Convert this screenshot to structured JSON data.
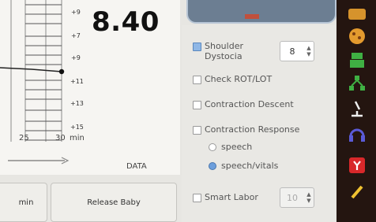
{
  "chart": {
    "scale_labels": [
      "+9",
      "+7",
      "+9",
      "+11",
      "+13",
      "+15"
    ],
    "x_ticks": [
      "25",
      "30"
    ],
    "x_unit": "min",
    "current_value": "8.40",
    "data_label": "DATA"
  },
  "buttons": {
    "min_label": "min",
    "release_baby": "Release Baby"
  },
  "options": {
    "shoulder_dystocia": {
      "label_line1": "Shoulder",
      "label_line2": "Dystocia",
      "checked": true,
      "value": "8"
    },
    "check_rot_lot": {
      "label": "Check ROT/LOT",
      "checked": false
    },
    "contraction_descent": {
      "label": "Contraction Descent",
      "checked": false
    },
    "contraction_response": {
      "label": "Contraction Response",
      "checked": false
    },
    "response_modes": [
      {
        "label": "speech",
        "selected": false
      },
      {
        "label": "speech/vitals",
        "selected": true
      }
    ],
    "smart_labor": {
      "label": "Smart Labor",
      "checked": false,
      "value": "10"
    }
  },
  "colors": {
    "accent_blue": "#6d9fdc",
    "sidebar_bg": "#241510",
    "alert_red": "#d8282a"
  },
  "sidebar_icons": [
    "cookie-icon",
    "robot-icon",
    "network-icon",
    "microscope-icon",
    "headset-icon",
    "alert-icon",
    "pencil-icon"
  ]
}
